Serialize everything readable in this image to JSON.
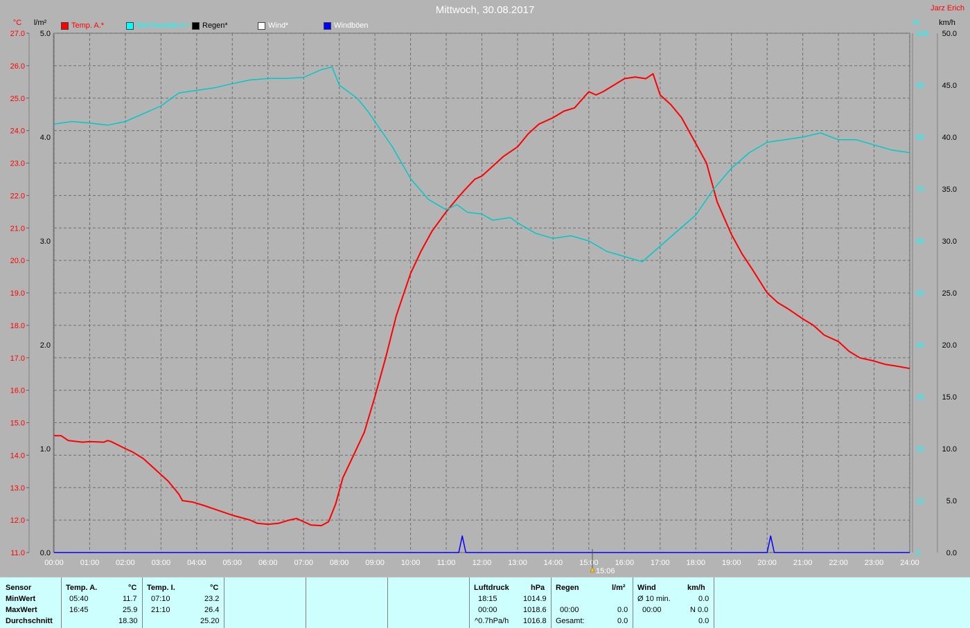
{
  "title": "Mittwoch, 30.08.2017",
  "author": "Jarz Erich",
  "legend": [
    {
      "label": "Temp. A.*",
      "color": "#ff0000",
      "text_color": "#ff0000"
    },
    {
      "label": "Rel.Feuchte A.*",
      "color": "#00ffff",
      "text_color": "#00ffff"
    },
    {
      "label": "Regen*",
      "color": "#000000",
      "text_color": "#000000"
    },
    {
      "label": "Wind*",
      "color": "#ffffff",
      "text_color": "#ffffff"
    },
    {
      "label": "Windböen",
      "color": "#0000ff",
      "text_color": "#ffffff"
    }
  ],
  "axis_units": {
    "temp": "°C",
    "rain": "l/m²",
    "humidity": "%",
    "wind": "km/h"
  },
  "now_marker": "15:06",
  "chart_data": {
    "type": "line",
    "title": "Mittwoch, 30.08.2017",
    "x_ticks": [
      "00:00",
      "01:00",
      "02:00",
      "03:00",
      "04:00",
      "05:00",
      "06:00",
      "07:00",
      "08:00",
      "09:00",
      "10:00",
      "11:00",
      "12:00",
      "13:00",
      "14:00",
      "15:00",
      "16:00",
      "17:00",
      "18:00",
      "19:00",
      "20:00",
      "21:00",
      "22:00",
      "23:00",
      "24:00"
    ],
    "axes": {
      "temp": {
        "ylim": [
          11.0,
          27.0
        ],
        "ticks": [
          "11.0",
          "12.0",
          "13.0",
          "14.0",
          "15.0",
          "16.0",
          "17.0",
          "18.0",
          "19.0",
          "20.0",
          "21.0",
          "22.0",
          "23.0",
          "24.0",
          "25.0",
          "26.0",
          "27.0"
        ]
      },
      "rain": {
        "ylim": [
          0.0,
          5.0
        ],
        "ticks": [
          "0.0",
          "1.0",
          "2.0",
          "3.0",
          "4.0",
          "5.0"
        ]
      },
      "humidity": {
        "ylim": [
          0,
          100
        ],
        "ticks": [
          "0",
          "10",
          "20",
          "30",
          "40",
          "50",
          "60",
          "70",
          "80",
          "90",
          "100"
        ]
      },
      "wind": {
        "ylim": [
          0.0,
          50.0
        ],
        "ticks": [
          "0.0",
          "5.0",
          "10.0",
          "15.0",
          "20.0",
          "25.0",
          "30.0",
          "35.0",
          "40.0",
          "45.0",
          "50.0"
        ]
      }
    },
    "grid": true,
    "series": [
      {
        "name": "Temp. A.*",
        "axis": "temp",
        "color": "#ff0000",
        "points": [
          [
            0,
            14.6
          ],
          [
            0.2,
            14.6
          ],
          [
            0.4,
            14.45
          ],
          [
            0.8,
            14.4
          ],
          [
            1.0,
            14.42
          ],
          [
            1.4,
            14.4
          ],
          [
            1.5,
            14.45
          ],
          [
            1.6,
            14.42
          ],
          [
            2.0,
            14.2
          ],
          [
            2.2,
            14.1
          ],
          [
            2.5,
            13.9
          ],
          [
            2.8,
            13.6
          ],
          [
            3.0,
            13.4
          ],
          [
            3.2,
            13.2
          ],
          [
            3.5,
            12.8
          ],
          [
            3.6,
            12.6
          ],
          [
            3.9,
            12.55
          ],
          [
            4.2,
            12.45
          ],
          [
            4.6,
            12.3
          ],
          [
            5.0,
            12.15
          ],
          [
            5.5,
            12.0
          ],
          [
            5.7,
            11.9
          ],
          [
            6.0,
            11.87
          ],
          [
            6.3,
            11.9
          ],
          [
            6.6,
            12.0
          ],
          [
            6.8,
            12.05
          ],
          [
            7.0,
            11.95
          ],
          [
            7.2,
            11.85
          ],
          [
            7.5,
            11.83
          ],
          [
            7.7,
            11.95
          ],
          [
            7.9,
            12.5
          ],
          [
            8.1,
            13.3
          ],
          [
            8.4,
            14.0
          ],
          [
            8.7,
            14.7
          ],
          [
            9.0,
            15.8
          ],
          [
            9.3,
            17.0
          ],
          [
            9.6,
            18.3
          ],
          [
            10.0,
            19.6
          ],
          [
            10.3,
            20.3
          ],
          [
            10.6,
            20.9
          ],
          [
            11.0,
            21.5
          ],
          [
            11.3,
            21.9
          ],
          [
            11.5,
            22.15
          ],
          [
            11.8,
            22.5
          ],
          [
            12.0,
            22.6
          ],
          [
            12.3,
            22.9
          ],
          [
            12.6,
            23.2
          ],
          [
            13.0,
            23.5
          ],
          [
            13.3,
            23.9
          ],
          [
            13.6,
            24.2
          ],
          [
            14.0,
            24.4
          ],
          [
            14.3,
            24.6
          ],
          [
            14.6,
            24.7
          ],
          [
            15.0,
            25.2
          ],
          [
            15.2,
            25.1
          ],
          [
            15.4,
            25.2
          ],
          [
            15.7,
            25.4
          ],
          [
            16.0,
            25.6
          ],
          [
            16.3,
            25.65
          ],
          [
            16.6,
            25.6
          ],
          [
            16.8,
            25.75
          ],
          [
            17.0,
            25.1
          ],
          [
            17.3,
            24.8
          ],
          [
            17.6,
            24.4
          ],
          [
            18.0,
            23.6
          ],
          [
            18.3,
            23.0
          ],
          [
            18.6,
            21.8
          ],
          [
            19.0,
            20.8
          ],
          [
            19.3,
            20.2
          ],
          [
            19.6,
            19.7
          ],
          [
            20.0,
            19.0
          ],
          [
            20.3,
            18.7
          ],
          [
            20.6,
            18.5
          ],
          [
            21.0,
            18.2
          ],
          [
            21.3,
            18.0
          ],
          [
            21.6,
            17.7
          ],
          [
            22.0,
            17.5
          ],
          [
            22.3,
            17.2
          ],
          [
            22.6,
            17.0
          ],
          [
            23.0,
            16.9
          ],
          [
            23.3,
            16.8
          ],
          [
            23.6,
            16.75
          ],
          [
            24.0,
            16.67
          ]
        ]
      },
      {
        "name": "Rel.Feuchte A.*",
        "axis": "humidity",
        "color": "#00c8c8",
        "points": [
          [
            0,
            82.5
          ],
          [
            0.5,
            83.0
          ],
          [
            1.0,
            82.7
          ],
          [
            1.5,
            82.3
          ],
          [
            2.0,
            83.0
          ],
          [
            2.5,
            84.5
          ],
          [
            3.0,
            86.0
          ],
          [
            3.5,
            88.5
          ],
          [
            4.0,
            89.0
          ],
          [
            4.5,
            89.5
          ],
          [
            5.0,
            90.3
          ],
          [
            5.5,
            91.0
          ],
          [
            6.0,
            91.3
          ],
          [
            6.5,
            91.3
          ],
          [
            7.0,
            91.5
          ],
          [
            7.5,
            93.0
          ],
          [
            7.8,
            93.5
          ],
          [
            8.0,
            90.0
          ],
          [
            8.5,
            87.5
          ],
          [
            8.8,
            85.0
          ],
          [
            9.0,
            83.0
          ],
          [
            9.5,
            78.0
          ],
          [
            10.0,
            72.0
          ],
          [
            10.5,
            68.0
          ],
          [
            11.0,
            66.0
          ],
          [
            11.3,
            67.0
          ],
          [
            11.6,
            65.5
          ],
          [
            12.0,
            65.2
          ],
          [
            12.3,
            64.0
          ],
          [
            12.8,
            64.5
          ],
          [
            13.0,
            63.5
          ],
          [
            13.5,
            61.5
          ],
          [
            14.0,
            60.5
          ],
          [
            14.5,
            61.0
          ],
          [
            15.0,
            60.0
          ],
          [
            15.5,
            58.0
          ],
          [
            16.0,
            57.0
          ],
          [
            16.5,
            56.0
          ],
          [
            17.0,
            59.0
          ],
          [
            17.5,
            62.0
          ],
          [
            18.0,
            65.0
          ],
          [
            18.5,
            70.0
          ],
          [
            19.0,
            74.0
          ],
          [
            19.5,
            77.0
          ],
          [
            20.0,
            79.0
          ],
          [
            20.5,
            79.5
          ],
          [
            21.0,
            80.0
          ],
          [
            21.5,
            80.8
          ],
          [
            22.0,
            79.5
          ],
          [
            22.5,
            79.5
          ],
          [
            23.0,
            78.5
          ],
          [
            23.5,
            77.5
          ],
          [
            24.0,
            77.0
          ]
        ]
      },
      {
        "name": "Windböen",
        "axis": "wind",
        "color": "#0000ff",
        "points": [
          [
            0,
            0
          ],
          [
            11.35,
            0
          ],
          [
            11.45,
            1.6
          ],
          [
            11.55,
            0
          ],
          [
            20.0,
            0
          ],
          [
            20.1,
            1.6
          ],
          [
            20.2,
            0
          ],
          [
            24.0,
            0
          ]
        ]
      }
    ]
  },
  "table": {
    "headers": {
      "sensor": "Sensor",
      "temp_a": "Temp. A.",
      "temp_a_unit": "°C",
      "temp_i": "Temp. I.",
      "temp_i_unit": "°C",
      "pressure": "Luftdruck",
      "pressure_unit": "hPa",
      "rain": "Regen",
      "rain_unit": "l/m²",
      "wind": "Wind",
      "wind_unit": "km/h"
    },
    "rows": {
      "min": "MinWert",
      "max": "MaxWert",
      "avg": "Durchschnitt"
    },
    "temp_a": {
      "min_time": "05:40",
      "min_val": "11.7",
      "max_time": "16:45",
      "max_val": "25.9",
      "avg": "18.30"
    },
    "temp_i": {
      "min_time": "07:10",
      "min_val": "23.2",
      "max_time": "21:10",
      "max_val": "26.4",
      "avg": "25.20"
    },
    "pressure": {
      "r1_label": "18:15",
      "r1_val": "1014.9",
      "r2_label": "00:00",
      "r2_val": "1018.6",
      "r3_label": "^0.7hPa/h",
      "r3_val": "1016.8"
    },
    "rain": {
      "r2_label": "00:00",
      "r2_val": "0.0",
      "r3_label": "Gesamt:",
      "r3_val": "0.0"
    },
    "wind": {
      "r1_label": "Ø 10 min.",
      "r1_val": "0.0",
      "r2_label": "00:00",
      "r2_val": "N 0.0",
      "r3_val": "0.0"
    }
  }
}
